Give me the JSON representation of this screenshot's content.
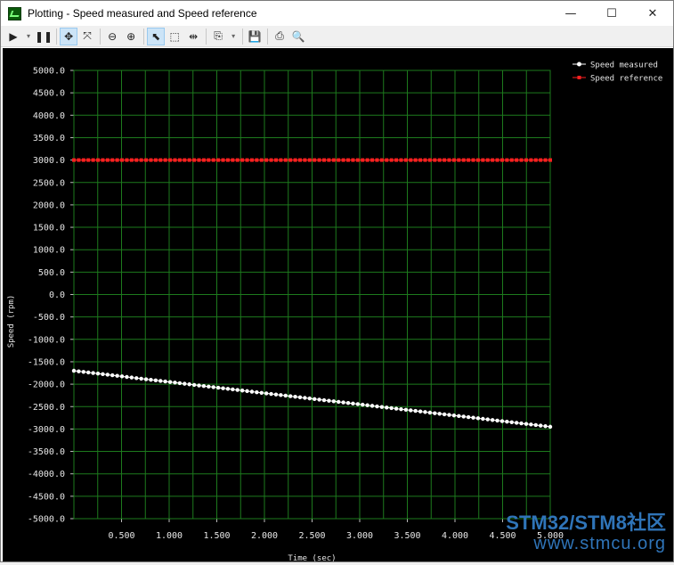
{
  "window": {
    "title": "Plotting  - Speed measured and Speed reference",
    "controls": [
      "—",
      "☐",
      "✕"
    ]
  },
  "toolbar": {
    "items": [
      {
        "name": "play-button",
        "glyph": "▶"
      },
      {
        "name": "play-dropdown",
        "glyph": "▾"
      },
      {
        "name": "pause-button",
        "glyph": "❚❚"
      },
      {
        "name": "pan-button",
        "glyph": "✥"
      },
      {
        "name": "zoom-fit-button",
        "glyph": "⤧"
      },
      {
        "name": "zoom-out-button",
        "glyph": "⊖"
      },
      {
        "name": "zoom-in-button",
        "glyph": "⊕"
      },
      {
        "name": "select-button",
        "glyph": "⬉"
      },
      {
        "name": "box-select-button",
        "glyph": "⬚"
      },
      {
        "name": "split-cursor-button",
        "glyph": "⇹"
      },
      {
        "name": "copy-button",
        "glyph": "⎘"
      },
      {
        "name": "copy-dropdown",
        "glyph": "▾"
      },
      {
        "name": "save-button",
        "glyph": "💾"
      },
      {
        "name": "print-button",
        "glyph": "⎙"
      },
      {
        "name": "print-preview-button",
        "glyph": "🔍"
      }
    ]
  },
  "watermark": {
    "line1": "STM32/STM8社区",
    "line2": "www.stmcu.org"
  },
  "chart_data": {
    "type": "line",
    "title": "",
    "xlabel": "Time (sec)",
    "ylabel": "Speed (rpm)",
    "xlim": [
      0.0,
      5.0
    ],
    "ylim": [
      -5000,
      5000
    ],
    "x_ticks": [
      "0.500",
      "1.000",
      "1.500",
      "2.000",
      "2.500",
      "3.000",
      "3.500",
      "4.000",
      "4.500",
      "5.000"
    ],
    "y_ticks": [
      "5000.0",
      "4500.0",
      "4000.0",
      "3500.0",
      "3000.0",
      "2500.0",
      "2000.0",
      "1500.0",
      "1000.0",
      "500.0",
      "0.0",
      "-500.0",
      "-1000.0",
      "-1500.0",
      "-2000.0",
      "-2500.0",
      "-3000.0",
      "-3500.0",
      "-4000.0",
      "-4500.0",
      "-5000.0"
    ],
    "grid": true,
    "legend_position": "top-right",
    "series": [
      {
        "name": "Speed measured",
        "color": "#ffffff",
        "x_start": 0.0,
        "x_end": 5.0,
        "y_start": -1700,
        "y_end": -2950,
        "points": 100
      },
      {
        "name": "Speed reference",
        "color": "#ff2020",
        "x_start": 0.0,
        "x_end": 5.0,
        "y_start": 3000,
        "y_end": 3000,
        "points": 100
      }
    ]
  }
}
